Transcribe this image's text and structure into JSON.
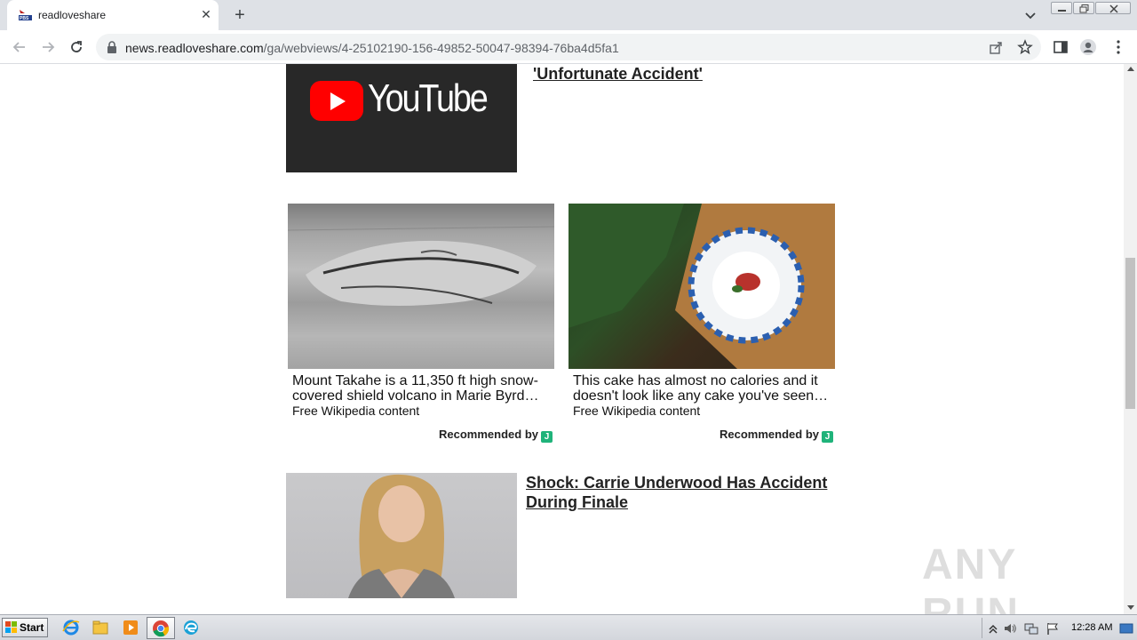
{
  "browser": {
    "tab_title": "readloveshare",
    "url_host": "news.readloveshare.com",
    "url_path": "/ga/webviews/4-25102190-156-49852-50047-98394-76ba4d5fa1"
  },
  "page": {
    "top_article": {
      "thumbnail_word": "YouTube",
      "title": "'Unfortunate Accident'"
    },
    "recommendations": [
      {
        "caption": "Mount Takahe is a 11,350 ft high snow-covered shield volcano in Marie Byrd…",
        "source": "Free Wikipedia content",
        "recommended_by": "Recommended by",
        "badge": "J"
      },
      {
        "caption": "This cake has almost no calories and it doesn't look like any cake you've seen…",
        "source": "Free Wikipedia content",
        "recommended_by": "Recommended by",
        "badge": "J"
      }
    ],
    "second_article": {
      "title": "Shock: Carrie Underwood Has Accident During Finale"
    },
    "watermark": "ANY RUN"
  },
  "taskbar": {
    "start_label": "Start",
    "clock": "12:28 AM"
  },
  "colors": {
    "youtube_red": "#ff0000",
    "badge_green": "#1fb37a",
    "chrome_tabstrip": "#dee1e6"
  }
}
